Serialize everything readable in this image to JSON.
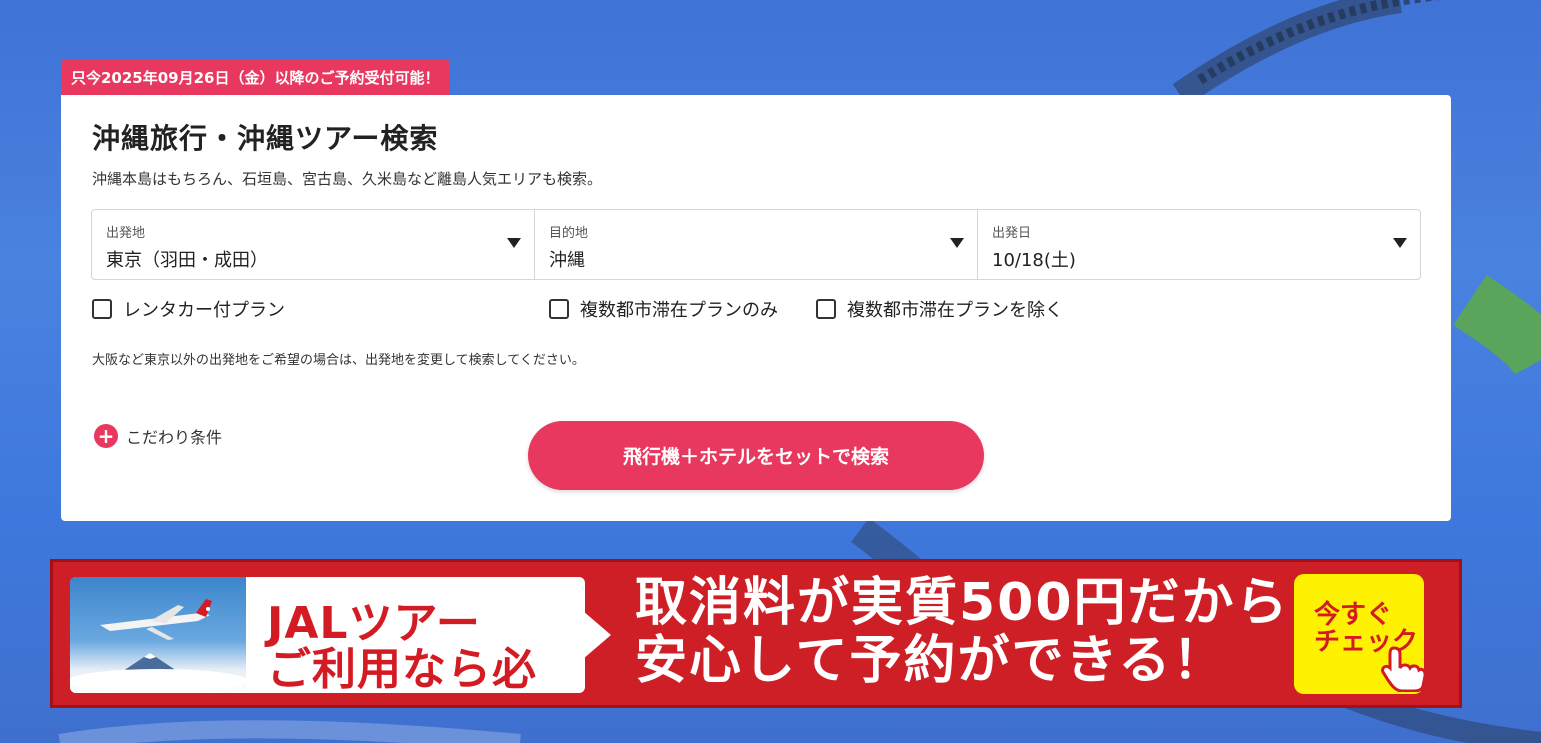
{
  "notice": "只今2025年09月26日（金）以降のご予約受付可能！",
  "search": {
    "title": "沖縄旅行・沖縄ツアー検索",
    "subtitle": "沖縄本島はもちろん、石垣島、宮古島、久米島など離島人気エリアも検索。",
    "fields": [
      {
        "label": "出発地",
        "value": "東京（羽田・成田）"
      },
      {
        "label": "目的地",
        "value": "沖縄"
      },
      {
        "label": "出発日",
        "value": "10/18(土)"
      }
    ],
    "checkboxes": [
      {
        "label": "レンタカー付プラン",
        "checked": false
      },
      {
        "label": "複数都市滞在プランのみ",
        "checked": false
      },
      {
        "label": "複数都市滞在プランを除く",
        "checked": false
      }
    ],
    "note": "大阪など東京以外の出発地をご希望の場合は、出発地を変更して検索してください。",
    "kodawari_label": "こだわり条件",
    "submit_label": "飛行機＋ホテルをセットで検索"
  },
  "banner": {
    "left_line1": "JALツアー",
    "left_line2": "ご利用なら必見！",
    "main_line1": "取消料が実質500円だから",
    "main_line2": "安心して予約ができる！",
    "cta_line1": "今すぐ",
    "cta_line2": "チェック"
  },
  "colors": {
    "accent": "#e8385f",
    "banner_red": "#cf1f26",
    "cta_yellow": "#fff200"
  }
}
